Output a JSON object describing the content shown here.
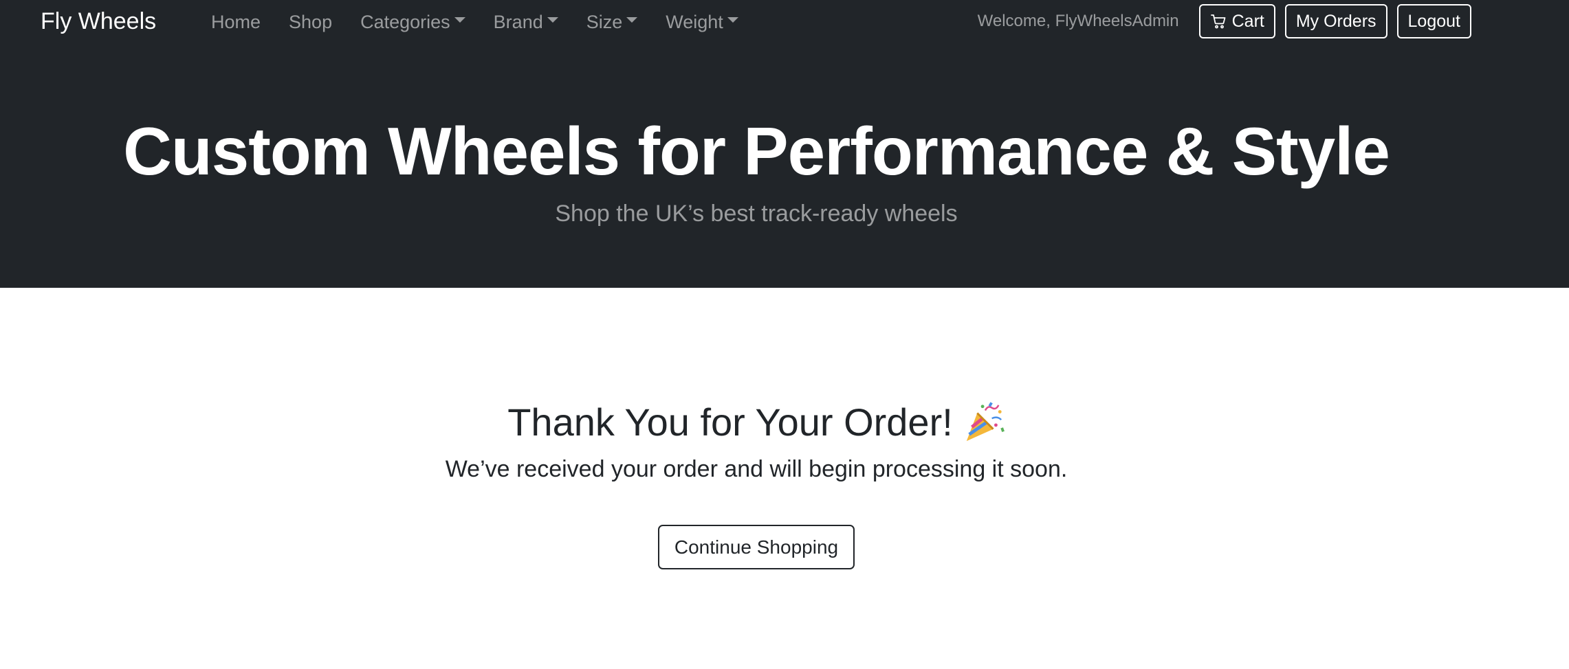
{
  "navbar": {
    "brand": "Fly Wheels",
    "links": [
      {
        "label": "Home"
      },
      {
        "label": "Shop"
      },
      {
        "label": "Categories"
      },
      {
        "label": "Brand"
      },
      {
        "label": "Size"
      },
      {
        "label": "Weight"
      }
    ],
    "welcome": "Welcome, FlyWheelsAdmin",
    "cart_label": "Cart",
    "orders_label": "My Orders",
    "logout_label": "Logout"
  },
  "hero": {
    "title": "Custom Wheels for Performance & Style",
    "subtitle": "Shop the UK’s best track-ready wheels"
  },
  "confirmation": {
    "title": "Thank You for Your Order!",
    "icon": "party-popper-icon",
    "message": "We’ve received your order and will begin processing it soon.",
    "button_label": "Continue Shopping"
  },
  "colors": {
    "navbar_bg": "#212529",
    "text_dark": "#212529",
    "muted": "rgba(255,255,255,0.55)"
  }
}
